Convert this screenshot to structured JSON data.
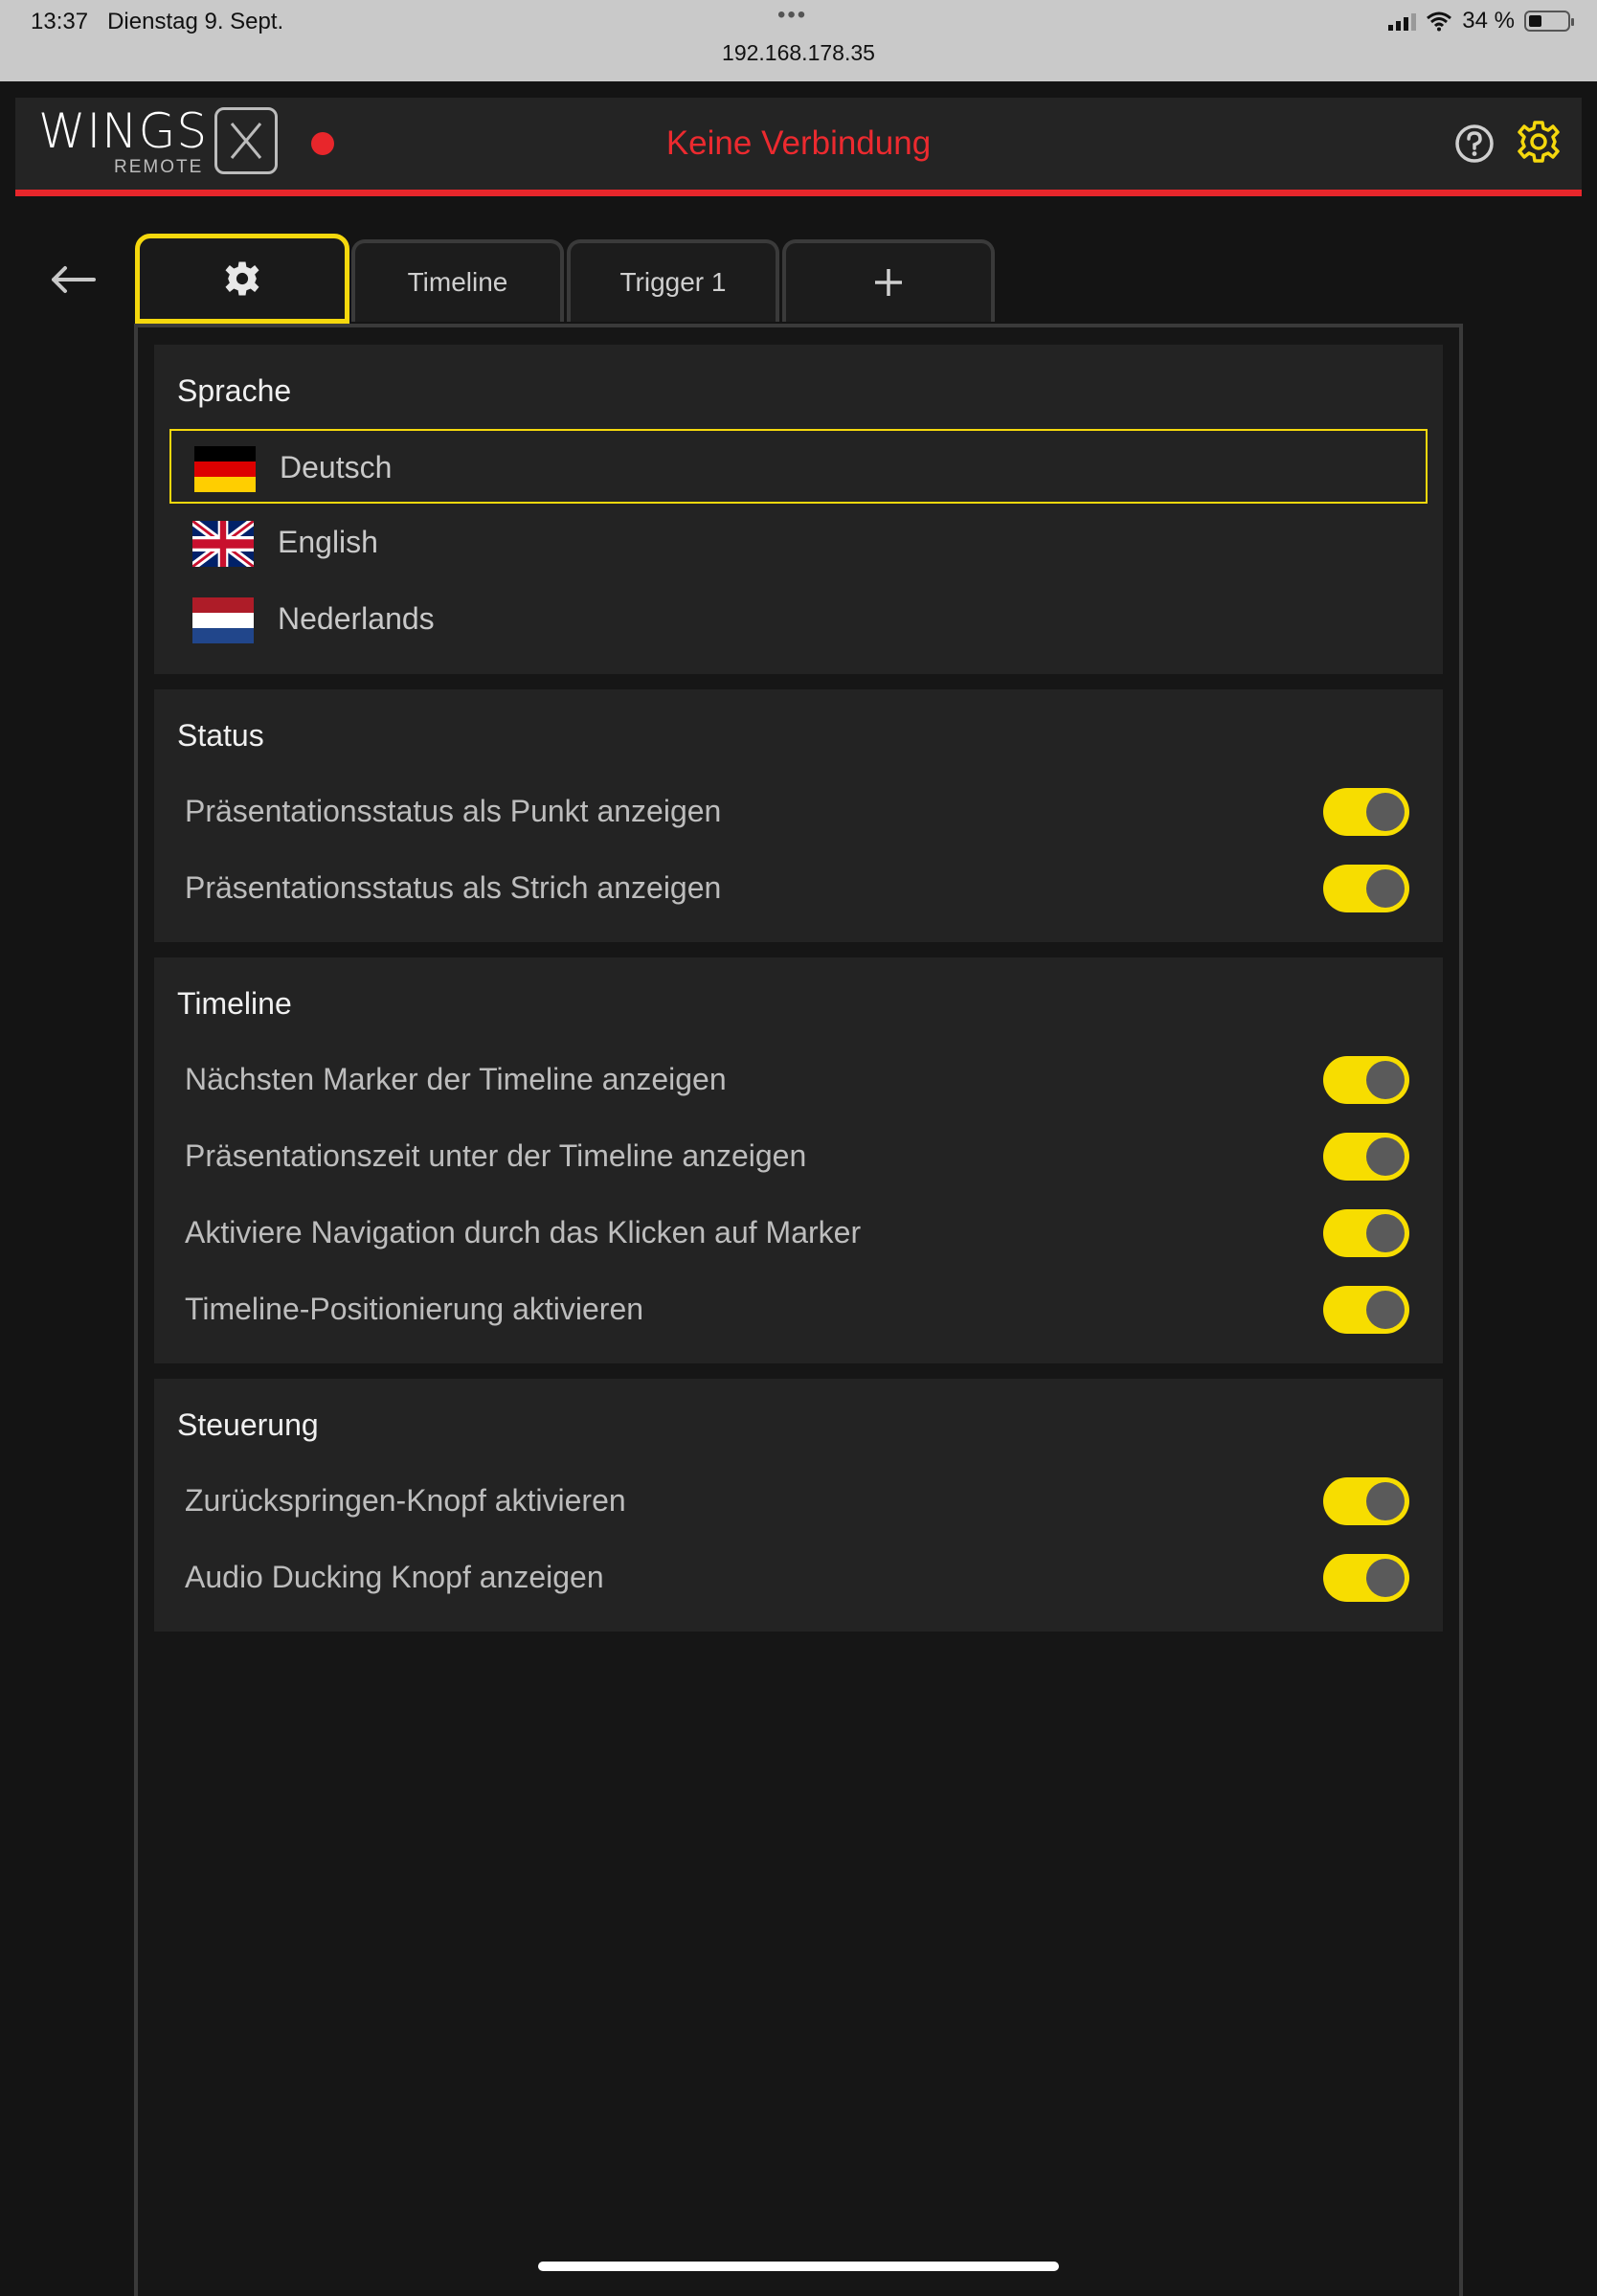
{
  "statusbar": {
    "time": "13:37",
    "date": "Dienstag 9. Sept.",
    "dots": "•••",
    "url": "192.168.178.35",
    "battery": "34 %",
    "battery_level": 0.34
  },
  "header": {
    "logo_word": "WINGS",
    "logo_sub": "REMOTE",
    "connection_status": "Keine Verbindung",
    "colors": {
      "accent": "#f5d80d",
      "alert": "#e8262b"
    }
  },
  "tabs": [
    {
      "id": "settings",
      "label": "",
      "icon": "gear-icon",
      "active": true
    },
    {
      "id": "timeline",
      "label": "Timeline",
      "active": false
    },
    {
      "id": "trigger1",
      "label": "Trigger 1",
      "active": false
    },
    {
      "id": "add",
      "label": "+",
      "icon": "plus-icon",
      "active": false
    }
  ],
  "sections": {
    "language": {
      "title": "Sprache",
      "options": [
        {
          "label": "Deutsch",
          "flag": "de-flag-icon",
          "selected": true
        },
        {
          "label": "English",
          "flag": "uk-flag-icon",
          "selected": false
        },
        {
          "label": "Nederlands",
          "flag": "nl-flag-icon",
          "selected": false
        }
      ]
    },
    "status": {
      "title": "Status",
      "items": [
        {
          "label": "Präsentationsstatus als Punkt anzeigen",
          "on": true
        },
        {
          "label": "Präsentationsstatus als Strich anzeigen",
          "on": true
        }
      ]
    },
    "timeline": {
      "title": "Timeline",
      "items": [
        {
          "label": "Nächsten Marker der Timeline anzeigen",
          "on": true
        },
        {
          "label": "Präsentationszeit unter der Timeline anzeigen",
          "on": true
        },
        {
          "label": "Aktiviere Navigation durch das Klicken auf Marker",
          "on": true
        },
        {
          "label": "Timeline-Positionierung aktivieren",
          "on": true
        }
      ]
    },
    "control": {
      "title": "Steuerung",
      "items": [
        {
          "label": "Zurückspringen-Knopf aktivieren",
          "on": true
        },
        {
          "label": "Audio Ducking Knopf anzeigen",
          "on": true
        }
      ]
    }
  }
}
